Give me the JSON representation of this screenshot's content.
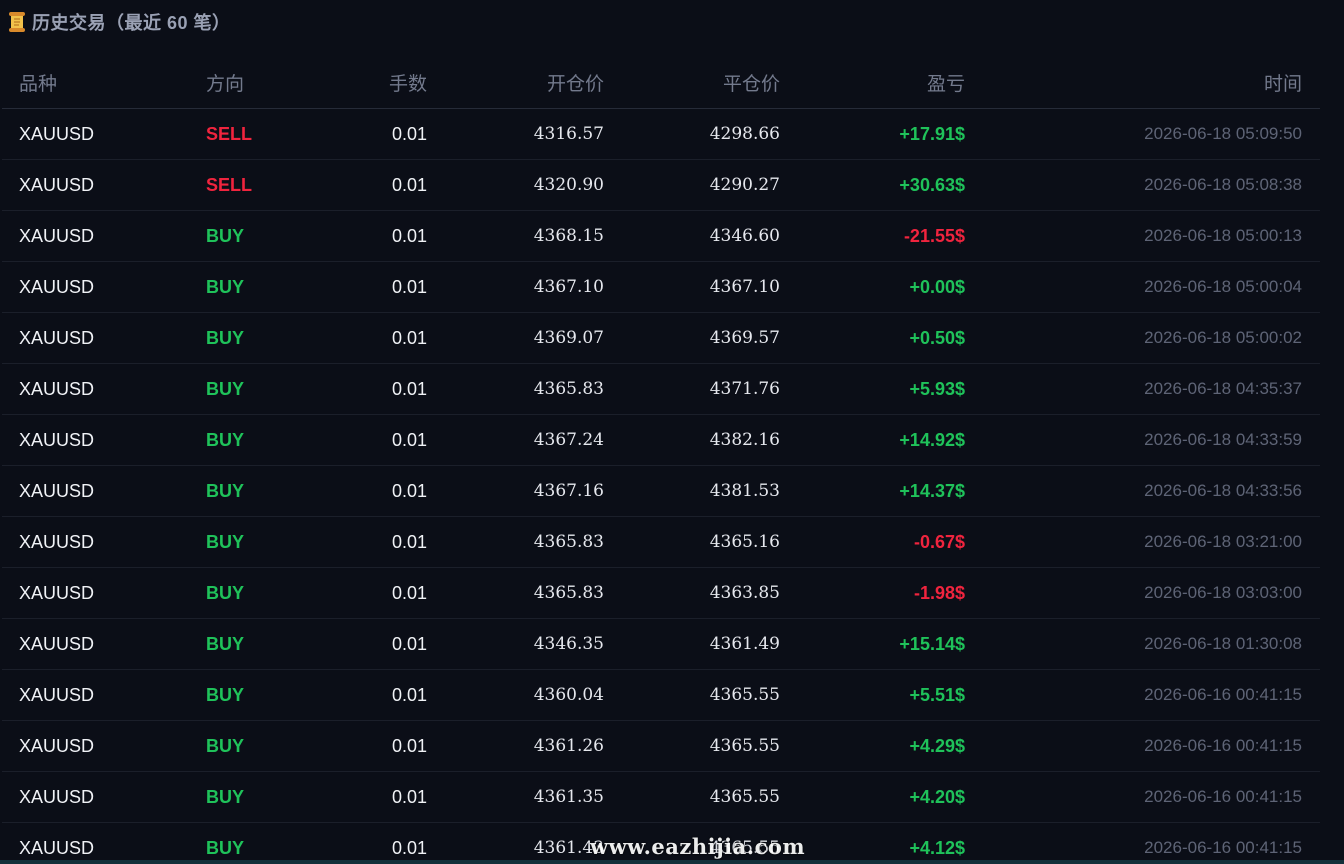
{
  "section": {
    "title": "历史交易（最近 60 笔）",
    "icon": "scroll-icon"
  },
  "table": {
    "columns": {
      "symbol": "品种",
      "direction": "方向",
      "lots": "手数",
      "open_price": "开仓价",
      "close_price": "平仓价",
      "pnl": "盈亏",
      "time": "时间"
    },
    "rows": [
      {
        "symbol": "XAUUSD",
        "direction": "SELL",
        "lots": "0.01",
        "open_price": "4316.57",
        "close_price": "4298.66",
        "pnl": "+17.91$",
        "time": "2026-06-18 05:09:50"
      },
      {
        "symbol": "XAUUSD",
        "direction": "SELL",
        "lots": "0.01",
        "open_price": "4320.90",
        "close_price": "4290.27",
        "pnl": "+30.63$",
        "time": "2026-06-18 05:08:38"
      },
      {
        "symbol": "XAUUSD",
        "direction": "BUY",
        "lots": "0.01",
        "open_price": "4368.15",
        "close_price": "4346.60",
        "pnl": "-21.55$",
        "time": "2026-06-18 05:00:13"
      },
      {
        "symbol": "XAUUSD",
        "direction": "BUY",
        "lots": "0.01",
        "open_price": "4367.10",
        "close_price": "4367.10",
        "pnl": "+0.00$",
        "time": "2026-06-18 05:00:04"
      },
      {
        "symbol": "XAUUSD",
        "direction": "BUY",
        "lots": "0.01",
        "open_price": "4369.07",
        "close_price": "4369.57",
        "pnl": "+0.50$",
        "time": "2026-06-18 05:00:02"
      },
      {
        "symbol": "XAUUSD",
        "direction": "BUY",
        "lots": "0.01",
        "open_price": "4365.83",
        "close_price": "4371.76",
        "pnl": "+5.93$",
        "time": "2026-06-18 04:35:37"
      },
      {
        "symbol": "XAUUSD",
        "direction": "BUY",
        "lots": "0.01",
        "open_price": "4367.24",
        "close_price": "4382.16",
        "pnl": "+14.92$",
        "time": "2026-06-18 04:33:59"
      },
      {
        "symbol": "XAUUSD",
        "direction": "BUY",
        "lots": "0.01",
        "open_price": "4367.16",
        "close_price": "4381.53",
        "pnl": "+14.37$",
        "time": "2026-06-18 04:33:56"
      },
      {
        "symbol": "XAUUSD",
        "direction": "BUY",
        "lots": "0.01",
        "open_price": "4365.83",
        "close_price": "4365.16",
        "pnl": "-0.67$",
        "time": "2026-06-18 03:21:00"
      },
      {
        "symbol": "XAUUSD",
        "direction": "BUY",
        "lots": "0.01",
        "open_price": "4365.83",
        "close_price": "4363.85",
        "pnl": "-1.98$",
        "time": "2026-06-18 03:03:00"
      },
      {
        "symbol": "XAUUSD",
        "direction": "BUY",
        "lots": "0.01",
        "open_price": "4346.35",
        "close_price": "4361.49",
        "pnl": "+15.14$",
        "time": "2026-06-18 01:30:08"
      },
      {
        "symbol": "XAUUSD",
        "direction": "BUY",
        "lots": "0.01",
        "open_price": "4360.04",
        "close_price": "4365.55",
        "pnl": "+5.51$",
        "time": "2026-06-16 00:41:15"
      },
      {
        "symbol": "XAUUSD",
        "direction": "BUY",
        "lots": "0.01",
        "open_price": "4361.26",
        "close_price": "4365.55",
        "pnl": "+4.29$",
        "time": "2026-06-16 00:41:15"
      },
      {
        "symbol": "XAUUSD",
        "direction": "BUY",
        "lots": "0.01",
        "open_price": "4361.35",
        "close_price": "4365.55",
        "pnl": "+4.20$",
        "time": "2026-06-16 00:41:15"
      },
      {
        "symbol": "XAUUSD",
        "direction": "BUY",
        "lots": "0.01",
        "open_price": "4361.43",
        "close_price": "4365.55",
        "pnl": "+4.12$",
        "time": "2026-06-16 00:41:15"
      }
    ]
  },
  "colors": {
    "background": "#0b0e17",
    "positive": "#1fc25a",
    "negative": "#f0243e",
    "buy": "#1fc25a",
    "sell": "#f0243e"
  },
  "watermark": "www.eazhijia.com"
}
